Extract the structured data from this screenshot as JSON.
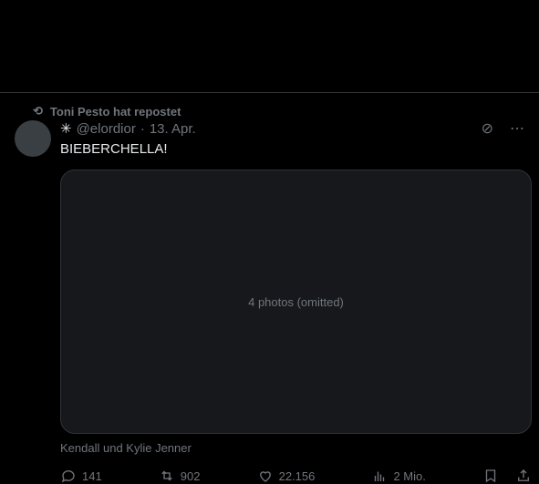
{
  "repost": {
    "label": "Toni Pesto hat repostet"
  },
  "post": {
    "handle": "@elordior",
    "date": "13. Apr.",
    "text": "BIEBERCHELLA!",
    "caption": "Kendall und Kylie Jenner",
    "media_placeholder": "4 photos (omitted)",
    "counts": {
      "replies": "141",
      "reposts": "902",
      "likes": "22.156",
      "views": "2 Mio."
    }
  }
}
